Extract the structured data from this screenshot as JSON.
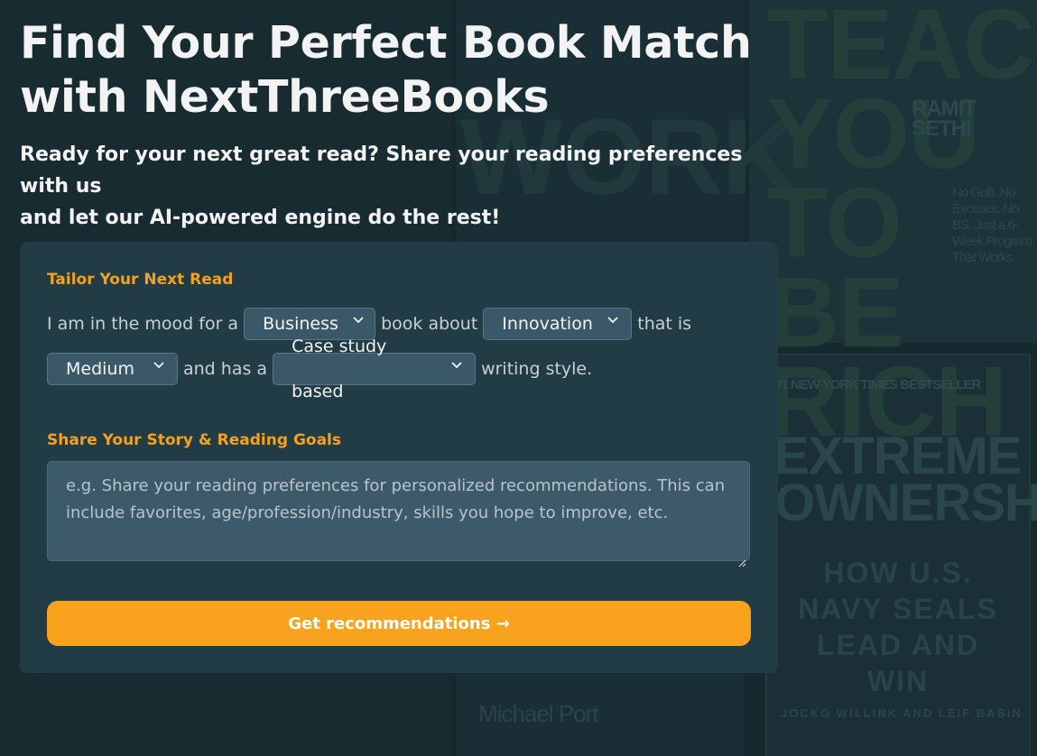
{
  "hero": {
    "title_line1": "Find Your Perfect Book Match",
    "title_line2": "with NextThreeBooks",
    "subtitle_line1": "Ready for your next great read? Share your reading preferences with us",
    "subtitle_line2": "and let our AI-powered engine do the rest!"
  },
  "form": {
    "tailor_label": "Tailor Your Next Read",
    "sentence": {
      "part1": "I am in the mood for a",
      "part2": "book about",
      "part3": "that is",
      "part4": "and has a",
      "part5": "writing style."
    },
    "selects": {
      "genre": "Business",
      "topic": "Innovation",
      "length": "Medium",
      "style": "Case study based"
    },
    "story_label": "Share Your Story & Reading Goals",
    "story_placeholder": "e.g. Share your reading preferences for personalized recommendations. This can include favorites, age/profession/industry, skills you hope to improve, etc.",
    "submit_label": "Get recommendations →"
  },
  "colors": {
    "accent": "#f9a21d",
    "label": "#f5a11f",
    "card": "#223c45",
    "background": "#16292f"
  },
  "icons": {
    "dropdown": "chevron-down-icon",
    "resize": "resize-grip-icon"
  },
  "background_covers": {
    "cover1_title": "TEACH YOU TO BE RICH",
    "cover1_author": "RAMIT SETHI",
    "cover1_tagline": "No Guilt. No Excuses. No BS. Just a 6-Week Program That Works.",
    "cover2_banner": "#1 NEW YORK TIMES BESTSELLER",
    "cover2_title": "EXTREME OWNERSHIP",
    "cover2_subtitle": "HOW U.S. NAVY SEALS LEAD AND WIN",
    "cover2_authors": "JOCKO WILLINK AND LEIF BABIN",
    "cover3_title": "WORK",
    "cover3_author": "Michael Port"
  }
}
